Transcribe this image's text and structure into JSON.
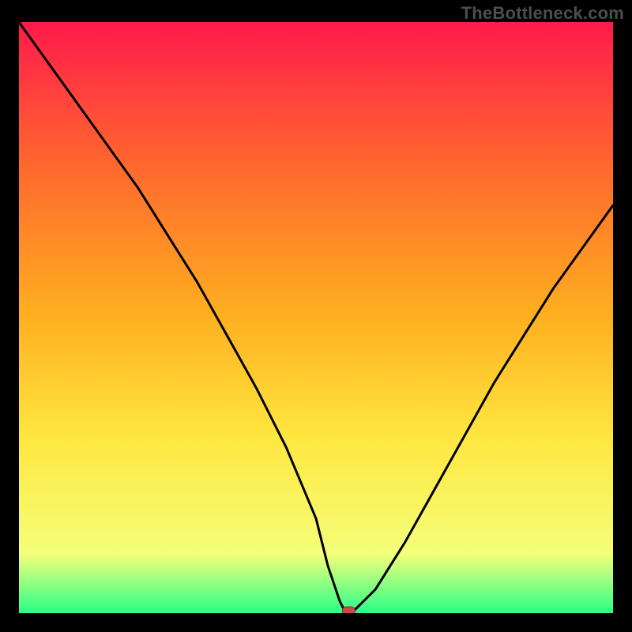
{
  "watermark": "TheBottleneck.com",
  "colors": {
    "frame": "#000000",
    "watermark_text": "#4d4d4d",
    "gradient_top": "#ff1a4b",
    "gradient_upper_mid": "#ff6a2d",
    "gradient_mid": "#ffb020",
    "gradient_lower_mid": "#ffe63f",
    "gradient_prebottom": "#f4ff7a",
    "gradient_bottom": "#2aff88",
    "curve_stroke": "#000000",
    "marker_fill": "#c94a4a",
    "marker_stroke": "#9a2f2f"
  },
  "chart_data": {
    "type": "line",
    "title": "",
    "xlabel": "",
    "ylabel": "",
    "xlim": [
      0,
      100
    ],
    "ylim": [
      0,
      100
    ],
    "series": [
      {
        "name": "bottleneck-curve",
        "x": [
          0,
          5,
          10,
          15,
          20,
          25,
          30,
          35,
          40,
          45,
          50,
          52,
          54,
          55,
          56,
          60,
          65,
          70,
          75,
          80,
          85,
          90,
          95,
          100
        ],
        "values": [
          100,
          93,
          86,
          79,
          72,
          64,
          56,
          47,
          38,
          28,
          16,
          8,
          2,
          0,
          0,
          4,
          12,
          21,
          30,
          39,
          47,
          55,
          62,
          69
        ]
      }
    ],
    "marker": {
      "x": 55.5,
      "y": 0
    },
    "annotations": []
  }
}
